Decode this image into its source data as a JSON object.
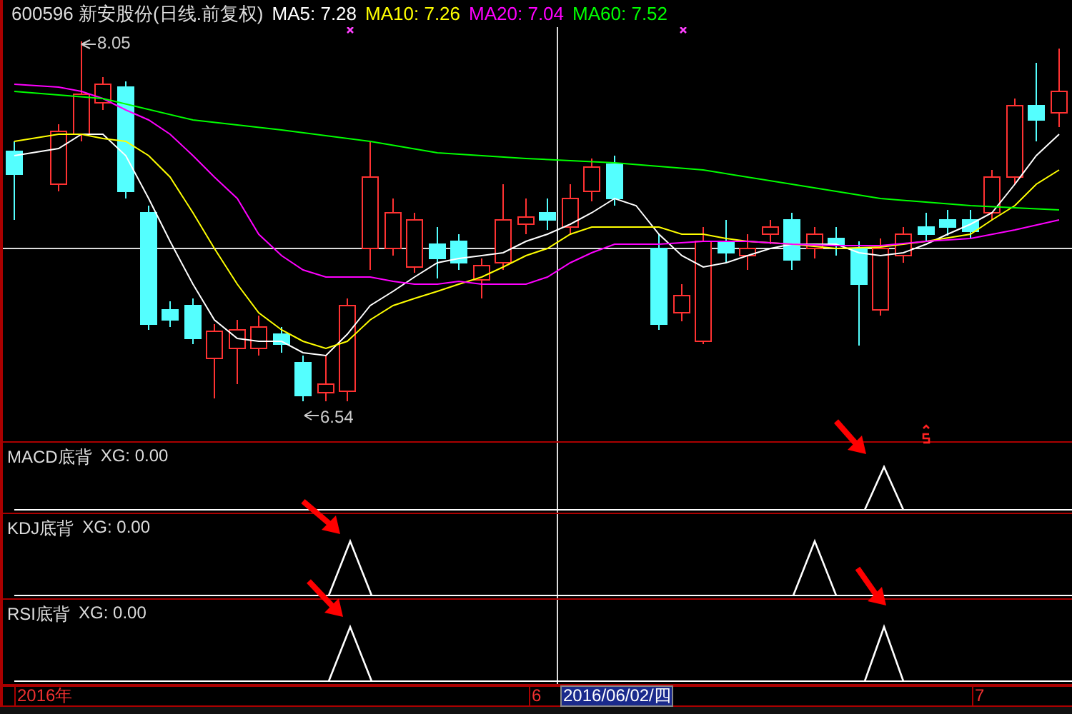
{
  "header": {
    "code": "600596",
    "name": "新安股份(日线.前复权)",
    "ma": [
      {
        "label": "MA5:",
        "value": "7.28",
        "color": "#ffffff"
      },
      {
        "label": "MA10:",
        "value": "7.26",
        "color": "#ffff00"
      },
      {
        "label": "MA20:",
        "value": "7.04",
        "color": "#ff00ff"
      },
      {
        "label": "MA60:",
        "value": "7.52",
        "color": "#00ff00"
      }
    ]
  },
  "price_chart": {
    "high_label": "8.05",
    "low_label": "6.54"
  },
  "panels": [
    {
      "title": "MACD底背",
      "reading": "XG: 0.00"
    },
    {
      "title": "KDJ底背",
      "reading": "XG: 0.00"
    },
    {
      "title": "RSI底背",
      "reading": "XG: 0.00"
    }
  ],
  "date_axis": [
    {
      "label": "2016年",
      "selected": false
    },
    {
      "label": "6",
      "selected": false
    },
    {
      "label": "2016/06/02/四",
      "selected": true
    },
    {
      "label": "7",
      "selected": false
    }
  ]
}
